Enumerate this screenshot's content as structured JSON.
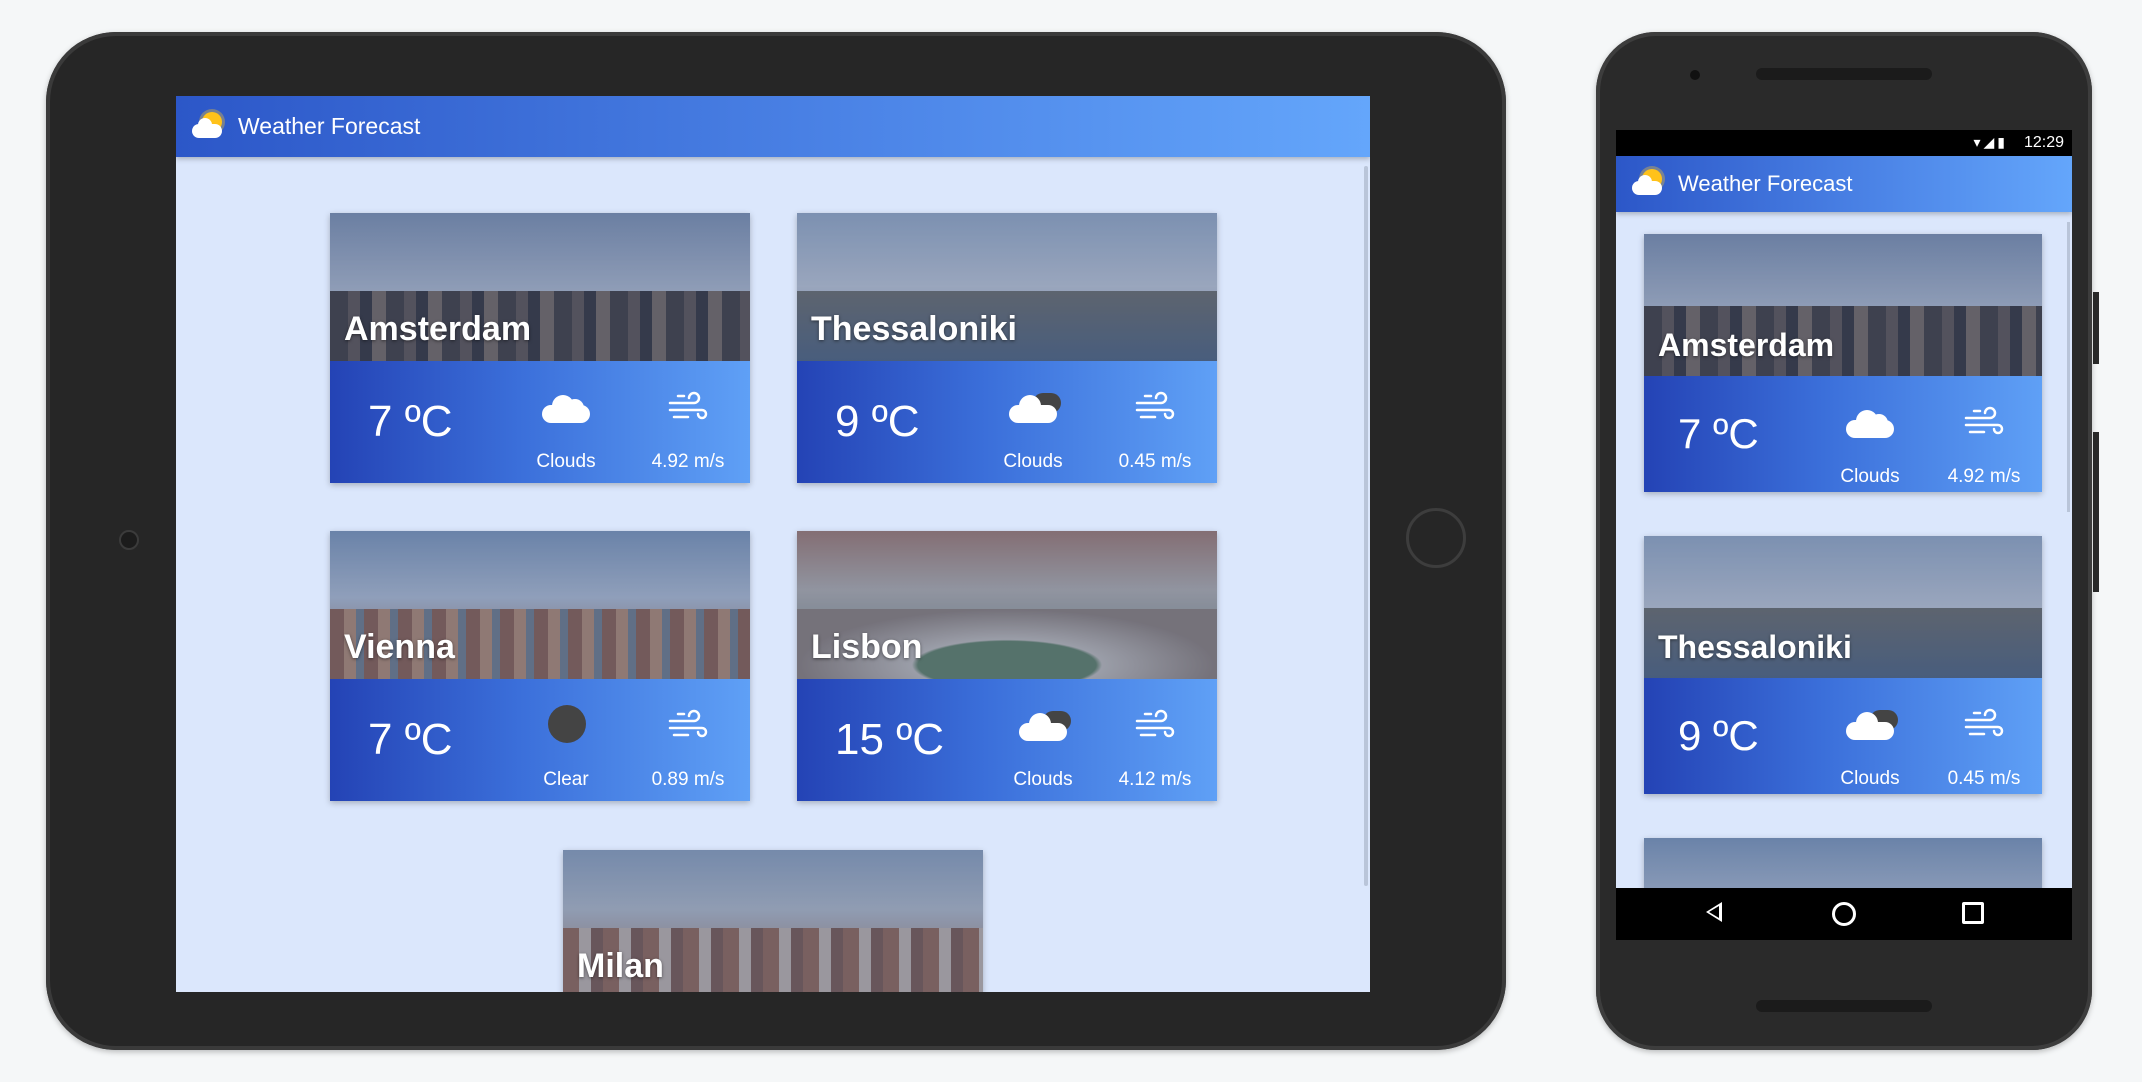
{
  "app": {
    "title": "Weather Forecast"
  },
  "tablet": {
    "cities": [
      {
        "name": "Amsterdam",
        "temp": "7",
        "unit": "ºC",
        "condition": "Clouds",
        "condition_icon": "cloud-icon",
        "wind": "4.92 m/s"
      },
      {
        "name": "Thessaloniki",
        "temp": "9",
        "unit": "ºC",
        "condition": "Clouds",
        "condition_icon": "dark-cloud-icon",
        "wind": "0.45 m/s"
      },
      {
        "name": "Vienna",
        "temp": "7",
        "unit": "ºC",
        "condition": "Clear",
        "condition_icon": "clear-icon",
        "wind": "0.89 m/s"
      },
      {
        "name": "Lisbon",
        "temp": "15",
        "unit": "ºC",
        "condition": "Clouds",
        "condition_icon": "dark-cloud-icon",
        "wind": "4.12 m/s"
      },
      {
        "name": "Milan"
      }
    ]
  },
  "phone": {
    "status_time": "12:29",
    "cities": [
      {
        "name": "Amsterdam",
        "temp": "7",
        "unit": "ºC",
        "condition": "Clouds",
        "condition_icon": "cloud-icon",
        "wind": "4.92 m/s"
      },
      {
        "name": "Thessaloniki",
        "temp": "9",
        "unit": "ºC",
        "condition": "Clouds",
        "condition_icon": "dark-cloud-icon",
        "wind": "0.45 m/s"
      }
    ]
  },
  "colors": {
    "appbar_start": "#2c57c8",
    "appbar_end": "#64a6fb",
    "screen_bg": "#dbe7fc",
    "card_info_start": "#2443b5",
    "card_info_end": "#5fa0f6"
  }
}
